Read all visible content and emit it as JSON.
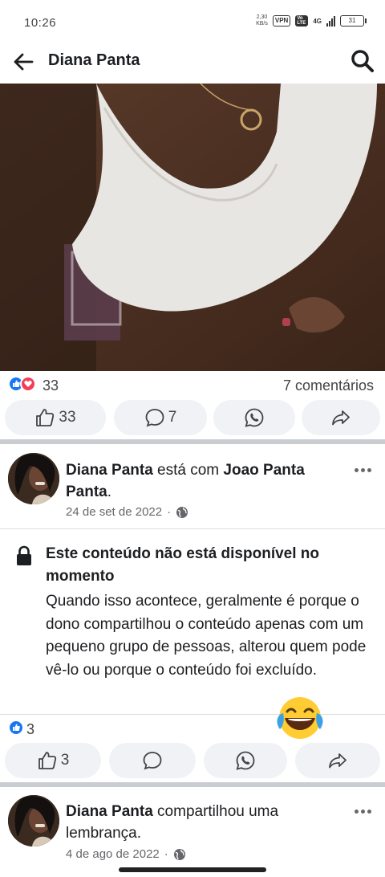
{
  "status_bar": {
    "time": "10:26",
    "net_speed_value": "2,30",
    "net_speed_unit": "KB/s",
    "vpn": "VPN",
    "volte": "Vo LTE",
    "network": "4G",
    "battery": "31"
  },
  "header": {
    "title": "Diana Panta"
  },
  "post1": {
    "reaction_count": "33",
    "comments": "7 comentários",
    "like_count": "33",
    "comment_count": "7"
  },
  "post2": {
    "author": "Diana Panta",
    "with_text": " está com ",
    "tagged": "Joao Panta Panta",
    "tagged_end": ".",
    "date": "24 de set de 2022",
    "unavailable_title": "Este conteúdo não está disponível no momento",
    "unavailable_body": "Quando isso acontece, geralmente é porque o dono compartilhou o conteúdo apenas com um pequeno grupo de pessoas, alterou quem pode vê-lo ou porque o conteúdo foi excluído.",
    "reaction_count": "3",
    "like_count": "3"
  },
  "post3": {
    "author": "Diana Panta",
    "action": " compartilhou uma lembrança.",
    "date": "4 de ago de 2022"
  },
  "colors": {
    "facebook_blue": "#1877f2",
    "love_red": "#f33e58",
    "button_bg": "#f0f2f5",
    "divider": "#c9ccd1"
  },
  "icons": [
    "back-arrow-icon",
    "search-icon",
    "like-icon",
    "comment-icon",
    "whatsapp-icon",
    "share-icon",
    "globe-icon",
    "lock-icon",
    "more-icon",
    "laughing-emoji-icon"
  ]
}
